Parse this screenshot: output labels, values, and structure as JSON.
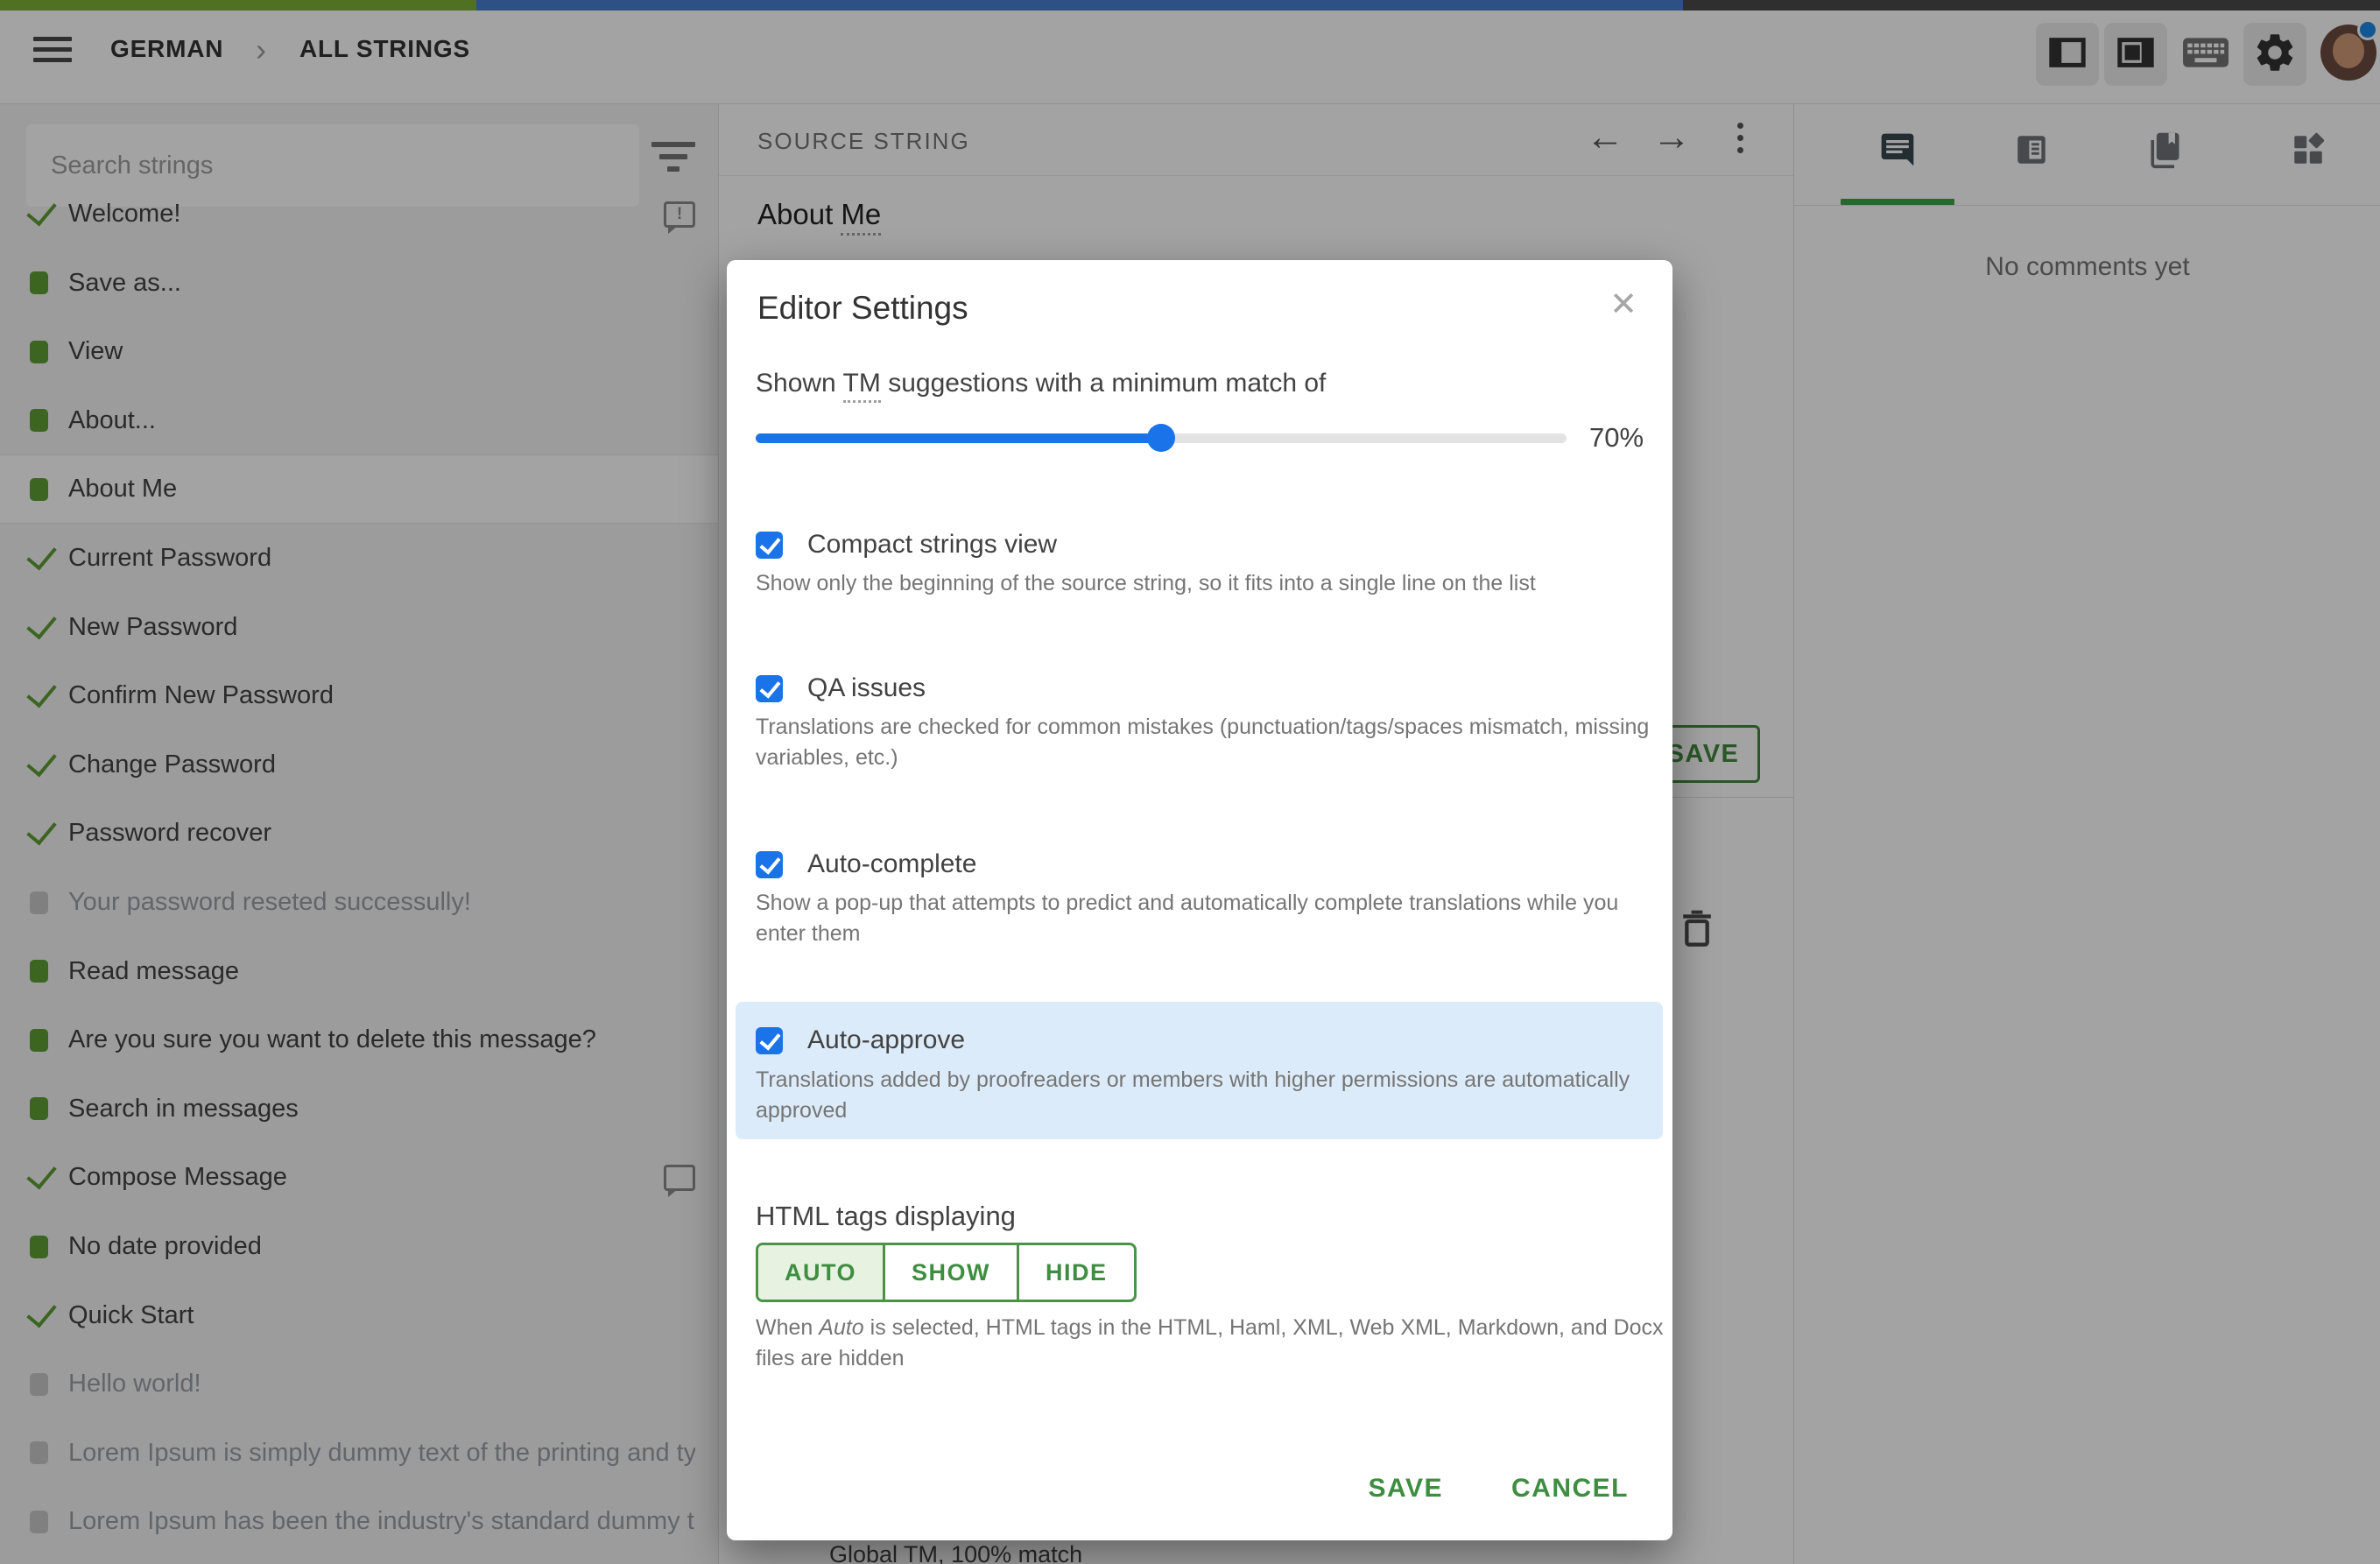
{
  "topbar": {
    "breadcrumb": {
      "project": "GERMAN",
      "section": "ALL STRINGS",
      "separator": "›"
    },
    "progress": {
      "approved_pct": 20,
      "translated_pct": 50.7,
      "approved_color": "#7fb136",
      "translated_color": "#477fd1",
      "rest_color": "#4a4a4a"
    }
  },
  "sidebar": {
    "search_placeholder": "Search strings",
    "alert_glyph": "!",
    "items": [
      {
        "label": "Welcome!",
        "status": "approved",
        "comment": "alert",
        "selected": false,
        "muted": false
      },
      {
        "label": "Save as...",
        "status": "translated",
        "comment": null,
        "selected": false,
        "muted": false
      },
      {
        "label": "View",
        "status": "translated",
        "comment": null,
        "selected": false,
        "muted": false
      },
      {
        "label": "About...",
        "status": "translated",
        "comment": null,
        "selected": false,
        "muted": false
      },
      {
        "label": "About Me",
        "status": "translated",
        "comment": null,
        "selected": true,
        "muted": false
      },
      {
        "label": "Current Password",
        "status": "approved",
        "comment": null,
        "selected": false,
        "muted": false
      },
      {
        "label": "New Password",
        "status": "approved",
        "comment": null,
        "selected": false,
        "muted": false
      },
      {
        "label": "Confirm New Password",
        "status": "approved",
        "comment": null,
        "selected": false,
        "muted": false
      },
      {
        "label": "Change Password",
        "status": "approved",
        "comment": null,
        "selected": false,
        "muted": false
      },
      {
        "label": "Password recover",
        "status": "approved",
        "comment": null,
        "selected": false,
        "muted": false
      },
      {
        "label": "Your password reseted successully!",
        "status": "untranslated",
        "comment": null,
        "selected": false,
        "muted": true
      },
      {
        "label": "Read message",
        "status": "translated",
        "comment": null,
        "selected": false,
        "muted": false
      },
      {
        "label": "Are you sure you want to delete this message?",
        "status": "translated",
        "comment": null,
        "selected": false,
        "muted": false
      },
      {
        "label": "Search in messages",
        "status": "translated",
        "comment": null,
        "selected": false,
        "muted": false
      },
      {
        "label": "Compose Message",
        "status": "approved",
        "comment": "plain",
        "selected": false,
        "muted": false
      },
      {
        "label": "No date provided",
        "status": "translated",
        "comment": null,
        "selected": false,
        "muted": false
      },
      {
        "label": "Quick Start",
        "status": "approved",
        "comment": null,
        "selected": false,
        "muted": false
      },
      {
        "label": "Hello world!",
        "status": "untranslated",
        "comment": null,
        "selected": false,
        "muted": true
      },
      {
        "label": "Lorem Ipsum is simply dummy text of the printing and ty...",
        "status": "untranslated",
        "comment": null,
        "selected": false,
        "muted": true
      },
      {
        "label": "Lorem Ipsum has been the industry's standard dummy t...",
        "status": "untranslated",
        "comment": null,
        "selected": false,
        "muted": true
      }
    ]
  },
  "source_panel": {
    "header": "SOURCE STRING",
    "back_glyph": "←",
    "forward_glyph": "→",
    "source_prefix": "About ",
    "source_underlined": "Me",
    "save_button": "SAVE",
    "suggestion_footer": "Global TM, 100% match"
  },
  "comments_panel": {
    "empty_text": "No comments yet"
  },
  "modal": {
    "title": "Editor Settings",
    "close_glyph": "✕",
    "tm_label_parts": {
      "before": "Shown ",
      "tm": "TM",
      "after": " suggestions with a minimum match of"
    },
    "slider": {
      "value_label": "70%",
      "fill_pct": 50,
      "color": "#1a73e8"
    },
    "checkbox_color": "#1a73e8",
    "highlight_color": "#dcebf9",
    "sections": [
      {
        "label": "Compact strings view",
        "desc": "Show only the beginning of the source string, so it fits into a single line on the list",
        "checked": true
      },
      {
        "label": "QA issues",
        "desc": "Translations are checked for common mistakes (punctuation/tags/spaces mismatch, missing variables, etc.)",
        "checked": true
      },
      {
        "label": "Auto-complete",
        "desc": "Show a pop-up that attempts to predict and automatically complete translations while you enter them",
        "checked": true
      },
      {
        "label": "Auto-approve",
        "desc": "Translations added by proofreaders or members with higher permissions are automatically approved",
        "checked": true,
        "highlighted": true
      }
    ],
    "html_tags": {
      "heading": "HTML tags displaying",
      "options": [
        "AUTO",
        "SHOW",
        "HIDE"
      ],
      "selected_index": 0,
      "desc_parts": {
        "before": "When ",
        "italic": "Auto",
        "after": " is selected, HTML tags in the HTML, Haml, XML, Web XML, Markdown, and Docx files are hidden"
      }
    },
    "buttons": {
      "save": "SAVE",
      "cancel": "CANCEL"
    }
  },
  "colors": {
    "accent_green": "#43883f",
    "tab_underline": "#43a047",
    "status_dot": "#1e88e5"
  }
}
